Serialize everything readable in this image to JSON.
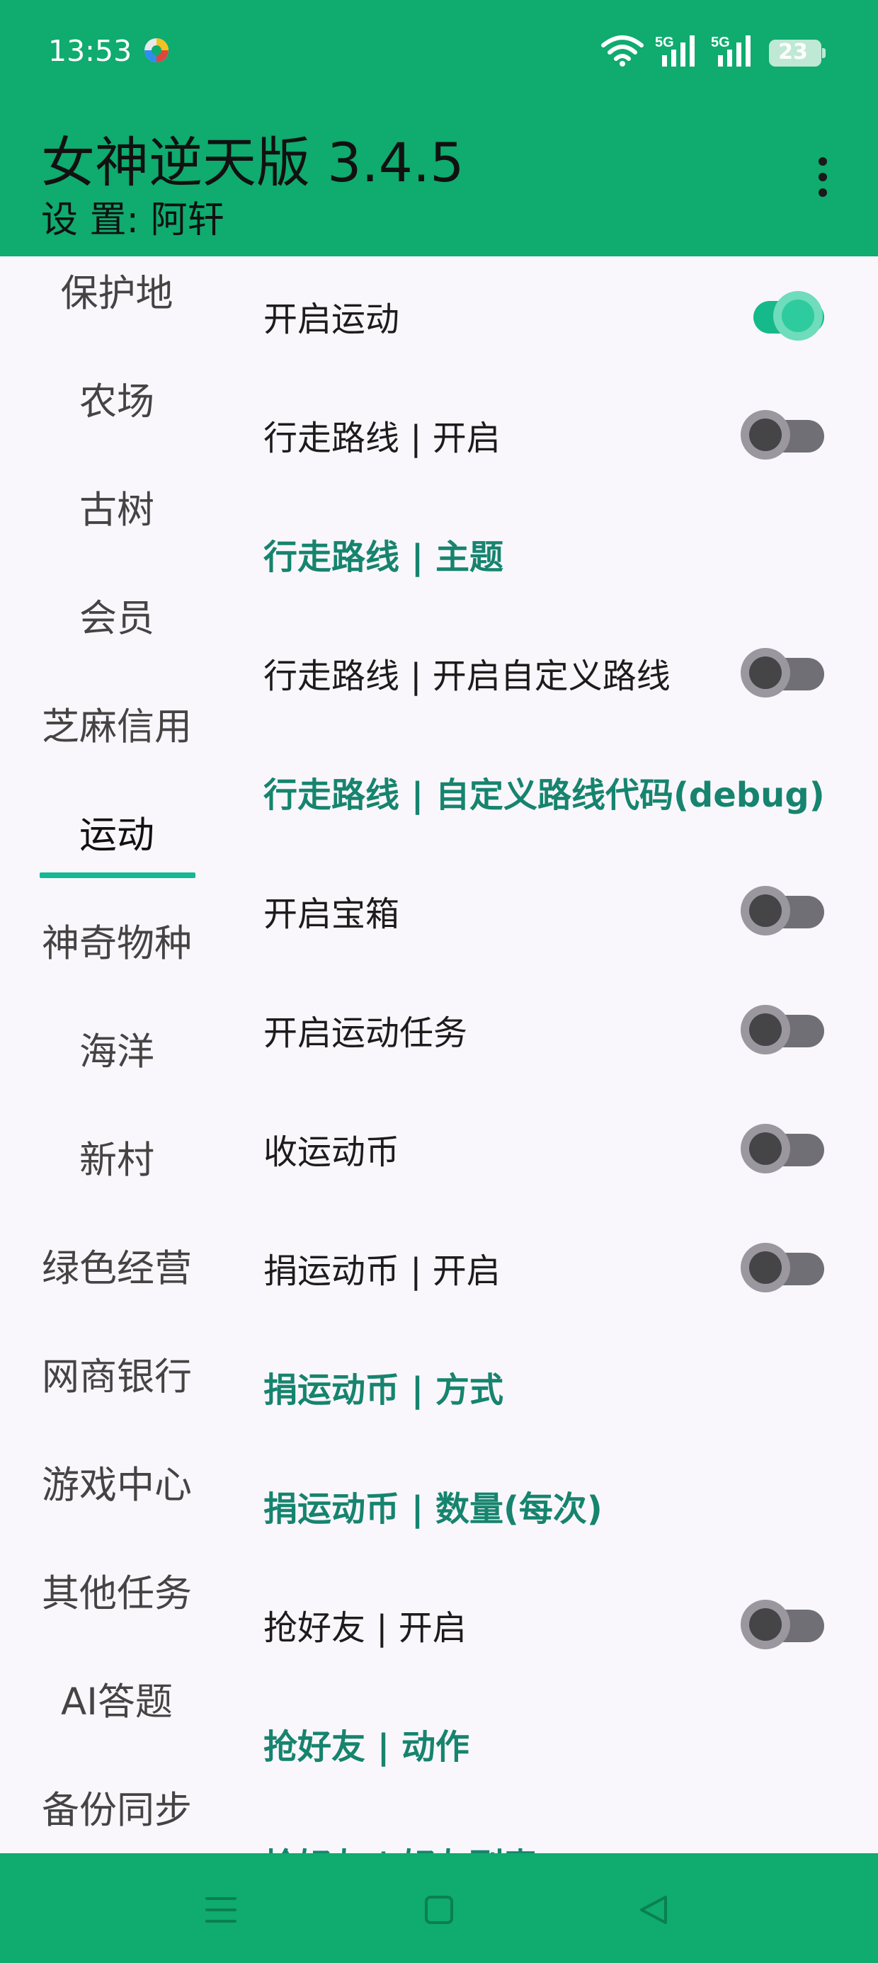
{
  "status_bar": {
    "time": "13:53",
    "battery_level": "23",
    "network_1": "5G",
    "network_2": "5G"
  },
  "app_bar": {
    "title": "女神逆天版 3.4.5",
    "subtitle": "设 置: 阿轩",
    "more_icon": "more-vertical-icon"
  },
  "sidebar": {
    "items": [
      {
        "label": "保护地"
      },
      {
        "label": "农场"
      },
      {
        "label": "古树"
      },
      {
        "label": "会员"
      },
      {
        "label": "芝麻信用"
      },
      {
        "label": "运动"
      },
      {
        "label": "神奇物种"
      },
      {
        "label": "海洋"
      },
      {
        "label": "新村"
      },
      {
        "label": "绿色经营"
      },
      {
        "label": "网商银行"
      },
      {
        "label": "游戏中心"
      },
      {
        "label": "其他任务"
      },
      {
        "label": "AI答题"
      },
      {
        "label": "备份同步"
      }
    ],
    "active": "运动"
  },
  "settings": {
    "rows": [
      {
        "label": "开启运动",
        "type": "switch",
        "on": true
      },
      {
        "label": "行走路线 | 开启",
        "type": "switch",
        "on": false
      },
      {
        "label": "行走路线 | 主题",
        "type": "link"
      },
      {
        "label": "行走路线 | 开启自定义路线",
        "type": "switch",
        "on": false
      },
      {
        "label": "行走路线 | 自定义路线代码(debug)",
        "type": "link"
      },
      {
        "label": "开启宝箱",
        "type": "switch",
        "on": false
      },
      {
        "label": "开启运动任务",
        "type": "switch",
        "on": false
      },
      {
        "label": "收运动币",
        "type": "switch",
        "on": false
      },
      {
        "label": "捐运动币 | 开启",
        "type": "switch",
        "on": false
      },
      {
        "label": "捐运动币 | 方式",
        "type": "link"
      },
      {
        "label": "捐运动币 | 数量(每次)",
        "type": "link"
      },
      {
        "label": "抢好友 | 开启",
        "type": "switch",
        "on": false
      },
      {
        "label": "抢好友 | 动作",
        "type": "link"
      },
      {
        "label": "抢好友 | 好友列表",
        "type": "link"
      }
    ]
  },
  "nav_bar": {
    "menu_icon": "menu-icon",
    "home_icon": "home-square-icon",
    "back_icon": "back-triangle-icon"
  },
  "colors": {
    "primary": "#0fab6f",
    "accent": "#16b98a",
    "link_text": "#16846e",
    "background": "#faf7fc"
  }
}
